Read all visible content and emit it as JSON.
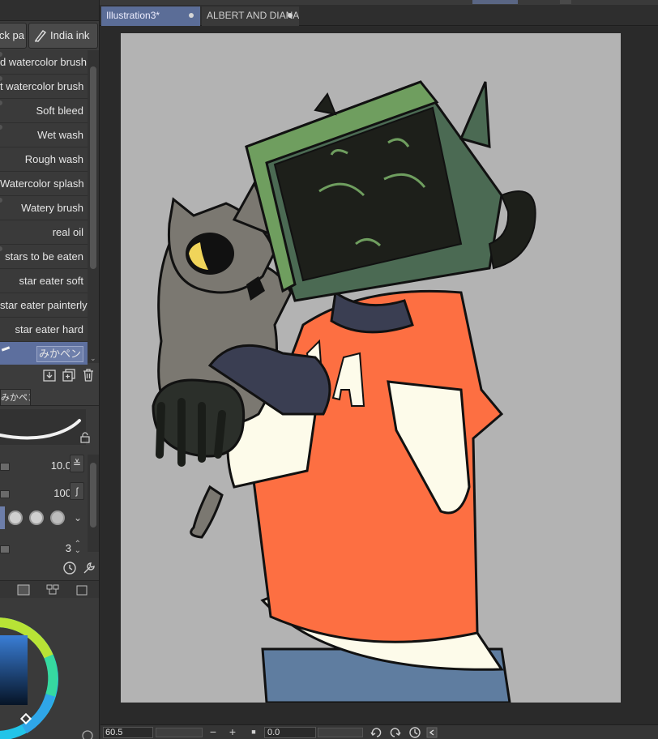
{
  "subtool_tabs": {
    "tab1": "ck pa",
    "tab2": "India ink"
  },
  "brushes": [
    {
      "label": "d watercolor brush"
    },
    {
      "label": "t watercolor brush"
    },
    {
      "label": "Soft bleed"
    },
    {
      "label": "Wet wash"
    },
    {
      "label": "Rough wash"
    },
    {
      "label": "Watercolor splash"
    },
    {
      "label": "Watery brush"
    },
    {
      "label": "real oil"
    },
    {
      "label": "stars to be eaten"
    },
    {
      "label": "star eater soft"
    },
    {
      "label": "star eater painterly"
    },
    {
      "label": "star eater hard"
    },
    {
      "label": "みかペン",
      "selected": true
    }
  ],
  "tool_property": {
    "tab": "みかペン",
    "size_value": "10.0",
    "opacity_value": "100",
    "stabilization_value": "3"
  },
  "document_tabs": {
    "active": "Illustration3*",
    "inactive": "ALBERT AND DIANA"
  },
  "status_bar": {
    "zoom": "60.5",
    "rotation": "0.0"
  },
  "colors": {
    "canvas_bg": "#b3b3b3",
    "selection": "#5d6f9e",
    "shirt": "#fd6f42",
    "monitor": "#6f9e5f",
    "cat": "#7b7871"
  },
  "icons": {
    "pen": "pen-icon",
    "save": "save-subtool-icon",
    "copy": "duplicate-subtool-icon",
    "delete": "trash-icon",
    "lock": "lock-icon",
    "settings": "wrench-icon"
  }
}
